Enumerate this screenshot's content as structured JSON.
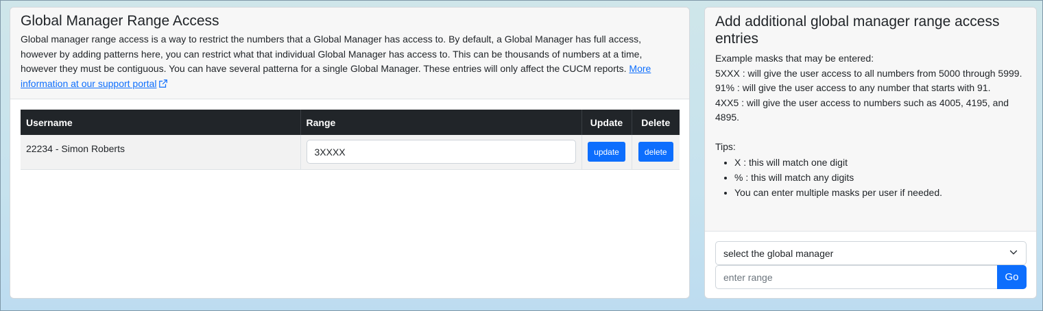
{
  "left_panel": {
    "title": "Global Manager Range Access",
    "description": "Global manager range access is a way to restrict the numbers that a Global Manager has access to. By default, a Global Manager has full access, however by adding patterns here, you can restrict what that individual Global Manager has access to. This can be thousands of numbers at a time, however they must be contiguous. You can have several patterna for a single Global Manager. These entries will only affect the CUCM reports.",
    "support_link": "More information at our support portal",
    "table": {
      "headers": [
        "Username",
        "Range",
        "Update",
        "Delete"
      ],
      "rows": [
        {
          "username": "22234 - Simon Roberts",
          "range": "3XXXX",
          "update_label": "update",
          "delete_label": "delete"
        }
      ]
    }
  },
  "right_panel": {
    "title": "Add additional global manager range access entries",
    "examples_intro": "Example masks that may be entered:",
    "examples": [
      "5XXX : will give the user access to all numbers from 5000 through 5999.",
      "91% : will give the user access to any number that starts with 91.",
      "4XX5 : will give the user access to numbers such as 4005, 4195, and 4895."
    ],
    "tips_label": "Tips:",
    "tips": [
      "X : this will match one digit",
      "% : this will match any digits",
      "You can enter multiple masks per user if needed."
    ],
    "select_placeholder": "select the global manager",
    "range_placeholder": "enter range",
    "go_label": "Go"
  },
  "icons": {
    "external_link": "external-link-icon",
    "dropdown": "chevron-down-icon"
  },
  "colors": {
    "primary": "#0d6efd",
    "table_header": "#212529"
  }
}
